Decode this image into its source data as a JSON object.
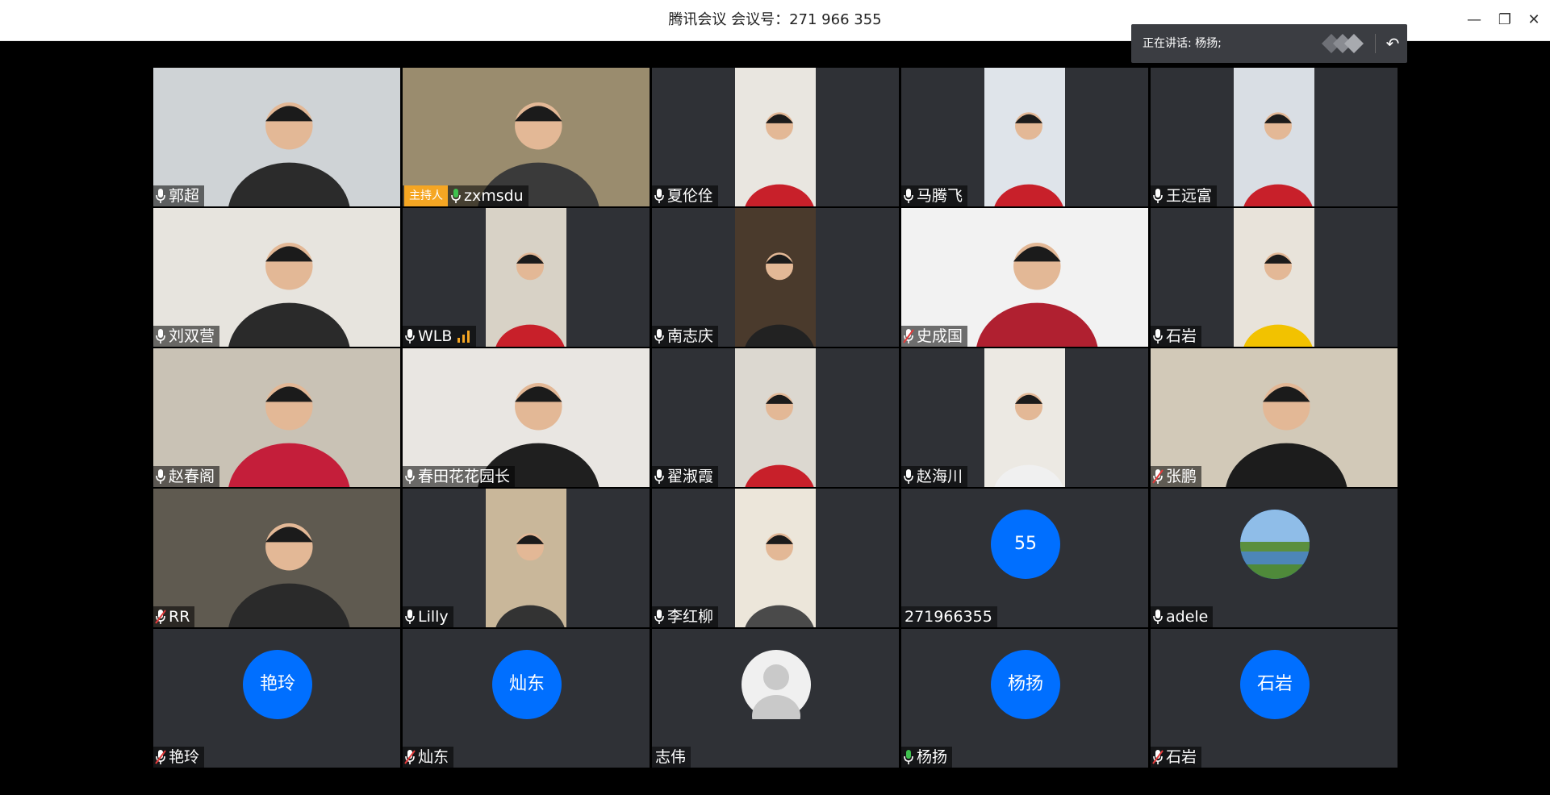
{
  "window": {
    "title": "腾讯会议 会议号：271 966 355",
    "minimize": "—",
    "restore": "❐",
    "close": "✕"
  },
  "speaking": {
    "label": "正在讲话: 杨扬;"
  },
  "colors": {
    "avatar_blue": "#006fff",
    "tile_bg": "#2f3136",
    "host_badge": "#f5a623",
    "mic_green": "#3ec14e"
  },
  "participants": [
    {
      "name": "郭超",
      "mic": "on",
      "video": "full",
      "bg": "#cfd3d6",
      "shirt": "#2b2b2b"
    },
    {
      "name": "zxmsdu",
      "mic": "talking",
      "host": "主持人",
      "video": "full",
      "bg": "#9a8c6e",
      "shirt": "#3a3a3a"
    },
    {
      "name": "夏伦佺",
      "mic": "on",
      "video": "portrait",
      "bg": "#e9e6e0",
      "shirt": "#c8202a"
    },
    {
      "name": "马腾飞",
      "mic": "on",
      "video": "portrait",
      "bg": "#dfe4ea",
      "shirt": "#c8202a"
    },
    {
      "name": "王远富",
      "mic": "on",
      "video": "portrait",
      "bg": "#d9dee4",
      "shirt": "#c8202a"
    },
    {
      "name": "刘双营",
      "mic": "on",
      "video": "full",
      "bg": "#e7e4de",
      "shirt": "#2a2a2a"
    },
    {
      "name": "WLB",
      "mic": "on",
      "signal": true,
      "video": "portrait",
      "bg": "#d8d2c6",
      "shirt": "#c8202a"
    },
    {
      "name": "南志庆",
      "mic": "on",
      "video": "portrait",
      "bg": "#4a3a2c",
      "shirt": "#222222"
    },
    {
      "name": "史成国",
      "mic": "muted",
      "video": "full",
      "bg": "#f2f2f2",
      "shirt": "#b02030"
    },
    {
      "name": "石岩",
      "mic": "on",
      "video": "portrait",
      "bg": "#e8e3da",
      "shirt": "#f2c200"
    },
    {
      "name": "赵春阁",
      "mic": "on",
      "video": "full",
      "bg": "#c9c2b5",
      "shirt": "#c41e3a"
    },
    {
      "name": "春田花花园长",
      "mic": "on",
      "video": "full",
      "bg": "#e9e6e2",
      "shirt": "#1f1f1f"
    },
    {
      "name": "翟淑霞",
      "mic": "on",
      "video": "portrait",
      "bg": "#dcd8d0",
      "shirt": "#c8202a"
    },
    {
      "name": "赵海川",
      "mic": "on",
      "video": "portrait",
      "bg": "#ece9e3",
      "shirt": "#f0f0f0"
    },
    {
      "name": "张鹏",
      "mic": "muted",
      "video": "full",
      "bg": "#d2c9b8",
      "shirt": "#1c1c1c"
    },
    {
      "name": "RR",
      "mic": "muted",
      "video": "full",
      "bg": "#5f5a50",
      "shirt": "#2a2a2a"
    },
    {
      "name": "Lilly",
      "mic": "on",
      "video": "portrait",
      "bg": "#c9b79a",
      "shirt": "#333333"
    },
    {
      "name": "李红柳",
      "mic": "on",
      "video": "portrait",
      "bg": "#ece6da",
      "shirt": "#4a4a4a"
    },
    {
      "name": "271966355",
      "mic": "none",
      "video": "avatar",
      "avatar_text": "55"
    },
    {
      "name": "adele",
      "mic": "on",
      "video": "avatar-photo",
      "avatar_text": ""
    },
    {
      "name": "艳玲",
      "mic": "muted",
      "video": "avatar",
      "avatar_text": "艳玲"
    },
    {
      "name": "灿东",
      "mic": "muted",
      "video": "avatar",
      "avatar_text": "灿东"
    },
    {
      "name": "志伟",
      "mic": "none",
      "video": "avatar-gray",
      "avatar_text": ""
    },
    {
      "name": "杨扬",
      "mic": "talking",
      "video": "avatar",
      "avatar_text": "杨扬"
    },
    {
      "name": "石岩",
      "mic": "muted",
      "video": "avatar",
      "avatar_text": "石岩"
    }
  ]
}
